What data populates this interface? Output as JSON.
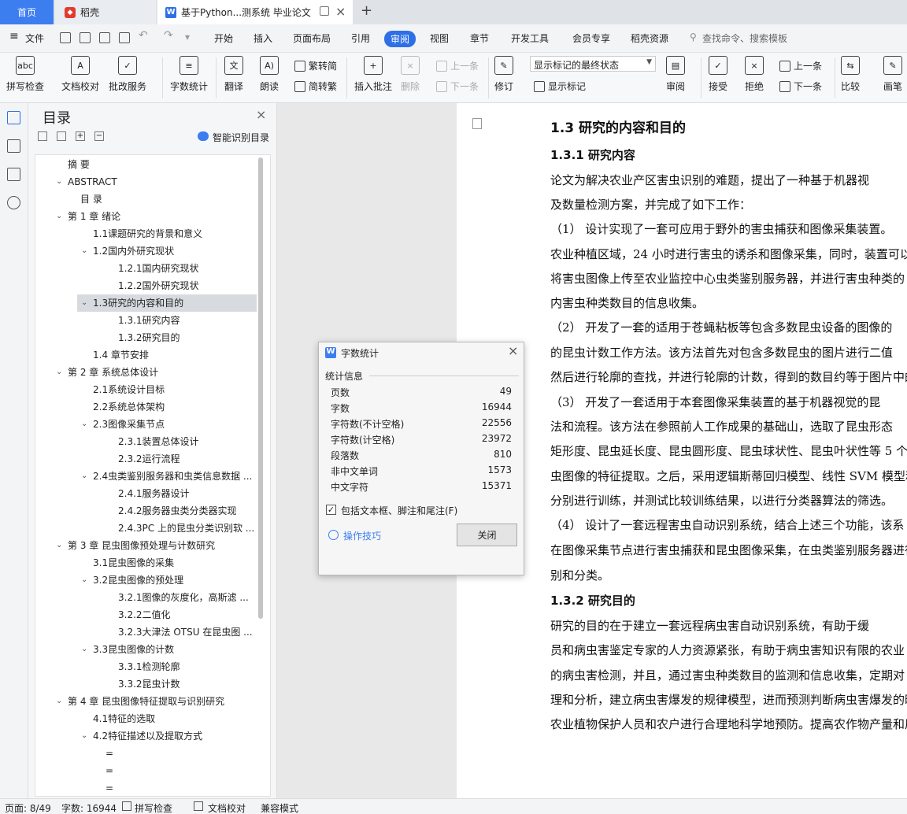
{
  "tabs": {
    "home": "首页",
    "docer": "稻壳",
    "doc": "基于Python...测系统 毕业论文",
    "new_tab": "+"
  },
  "menu": {
    "file": "文件",
    "items": [
      "开始",
      "插入",
      "页面布局",
      "引用",
      "审阅",
      "视图",
      "章节",
      "开发工具",
      "会员专享",
      "稻壳资源"
    ],
    "search_placeholder": "查找命令、搜索模板"
  },
  "ribbon": {
    "spell": "拼写检查",
    "doc_check": "文档校对",
    "batch": "批改服务",
    "word_count": "字数统计",
    "translate": "翻译",
    "read": "朗读",
    "trad": "繁转简",
    "simp": "简转繁",
    "insert_comment": "插入批注",
    "delete": "删除",
    "prev1": "上一条",
    "next1": "下一条",
    "revise": "修订",
    "markup_select": "显示标记的最终状态",
    "show_markup": "显示标记",
    "review": "审阅",
    "accept": "接受",
    "reject": "拒绝",
    "prev2": "上一条",
    "next2": "下一条",
    "compare": "比较",
    "draw": "画笔"
  },
  "toc": {
    "title": "目录",
    "smart": "智能识别目录",
    "items": [
      {
        "label": "摘  要",
        "arrow": ""
      },
      {
        "label": "ABSTRACT",
        "arrow": "v"
      },
      {
        "label": "目  录",
        "arrow": ""
      },
      {
        "label": "第 1 章 绪论",
        "arrow": "v"
      },
      {
        "label": "1.1课题研究的背景和意义",
        "arrow": ""
      },
      {
        "label": "1.2国内外研究现状",
        "arrow": "v"
      },
      {
        "label": "1.2.1国内研究现状",
        "arrow": ""
      },
      {
        "label": "1.2.2国外研究现状",
        "arrow": ""
      },
      {
        "label": "1.3研究的内容和目的",
        "arrow": "v"
      },
      {
        "label": "1.3.1研究内容",
        "arrow": ""
      },
      {
        "label": "1.3.2研究目的",
        "arrow": ""
      },
      {
        "label": "1.4 章节安排",
        "arrow": ""
      },
      {
        "label": "第 2 章 系统总体设计",
        "arrow": "v"
      },
      {
        "label": "2.1系统设计目标",
        "arrow": ""
      },
      {
        "label": "2.2系统总体架构",
        "arrow": ""
      },
      {
        "label": "2.3图像采集节点",
        "arrow": "v"
      },
      {
        "label": "2.3.1装置总体设计",
        "arrow": ""
      },
      {
        "label": "2.3.2运行流程",
        "arrow": ""
      },
      {
        "label": "2.4虫类鉴别服务器和虫类信息数据 ...",
        "arrow": "v"
      },
      {
        "label": "2.4.1服务器设计",
        "arrow": ""
      },
      {
        "label": "2.4.2服务器虫类分类器实现",
        "arrow": ""
      },
      {
        "label": "2.4.3PC 上的昆虫分类识别软 ...",
        "arrow": ""
      },
      {
        "label": "第 3 章 昆虫图像预处理与计数研究",
        "arrow": "v"
      },
      {
        "label": "3.1昆虫图像的采集",
        "arrow": ""
      },
      {
        "label": "3.2昆虫图像的预处理",
        "arrow": "v"
      },
      {
        "label": "3.2.1图像的灰度化，高斯滤 ...",
        "arrow": ""
      },
      {
        "label": "3.2.2二值化",
        "arrow": ""
      },
      {
        "label": "3.2.3大津法 OTSU 在昆虫图 ...",
        "arrow": ""
      },
      {
        "label": "3.3昆虫图像的计数",
        "arrow": "v"
      },
      {
        "label": "3.3.1检测轮廓",
        "arrow": ""
      },
      {
        "label": "3.3.2昆虫计数",
        "arrow": ""
      },
      {
        "label": "第 4 章 昆虫图像特征提取与识别研究",
        "arrow": "v"
      },
      {
        "label": "4.1特征的选取",
        "arrow": ""
      },
      {
        "label": "4.2特征描述以及提取方式",
        "arrow": "v"
      },
      {
        "label": "=",
        "arrow": ""
      },
      {
        "label": "=",
        "arrow": ""
      },
      {
        "label": "=",
        "arrow": ""
      }
    ]
  },
  "document": {
    "lines": [
      "1.3 研究的内容和目的",
      "1.3.1 研究内容",
      "    论文为解决农业产区害虫识别的难题，提出了一种基于机器视",
      "及数量检测方案，并完成了如下工作：",
      "（1） 设计实现了一套可应用于野外的害虫捕获和图像采集装置。",
      "农业种植区域，24 小时进行害虫的诱杀和图像采集，同时，装置可以",
      "将害虫图像上传至农业监控中心虫类鉴别服务器，并进行害虫种类的",
      "内害虫种类数目的信息收集。",
      "（2） 开发了一套的适用于苍蝇粘板等包含多数昆虫设备的图像的",
      "的昆虫计数工作方法。该方法首先对包含多数昆虫的图片进行二值",
      "然后进行轮廓的查找，并进行轮廓的计数，得到的数目约等于图片中的",
      "（3） 开发了一套适用于本套图像采集装置的基于机器视觉的昆",
      "法和流程。该方法在参照前人工作成果的基础山，选取了昆虫形态",
      "矩形度、昆虫延长度、昆虫圆形度、昆虫球状性、昆虫叶状性等 5 个",
      "虫图像的特征提取。之后，采用逻辑斯蒂回归模型、线性 SVM 模型和",
      "分别进行训练，并测试比较训练结果，以进行分类器算法的筛选。",
      "（4） 设计了一套远程害虫自动识别系统，结合上述三个功能，该系",
      "在图像采集节点进行害虫捕获和昆虫图像采集，在虫类鉴别服务器进行",
      "别和分类。",
      "1.3.2 研究目的",
      "    研究的目的在于建立一套远程病虫害自动识别系统，有助于缓",
      "员和病虫害鉴定专家的人力资源紧张，有助于病虫害知识有限的农业",
      "的病虫害检测，并且，通过害虫种类数目的监测和信息收集，定期对",
      "理和分析，建立病虫害爆发的规律模型，进而预测判断病虫害爆发的时",
      "农业植物保护人员和农户进行合理地科学地预防。提高农作物产量和质量"
    ]
  },
  "dialog": {
    "title": "字数统计",
    "section": "统计信息",
    "stats": [
      {
        "label": "页数",
        "value": "49"
      },
      {
        "label": "字数",
        "value": "16944"
      },
      {
        "label": "字符数(不计空格)",
        "value": "22556"
      },
      {
        "label": "字符数(计空格)",
        "value": "23972"
      },
      {
        "label": "段落数",
        "value": "810"
      },
      {
        "label": "非中文单词",
        "value": "1573"
      },
      {
        "label": "中文字符",
        "value": "15371"
      }
    ],
    "checkbox": "包括文本框、脚注和尾注(F)",
    "tips": "操作技巧",
    "close": "关闭"
  },
  "status": {
    "page": "页面: 8/49",
    "words": "字数: 16944",
    "spell": "拼写检查",
    "doc_check": "文档校对",
    "compat": "兼容模式"
  }
}
